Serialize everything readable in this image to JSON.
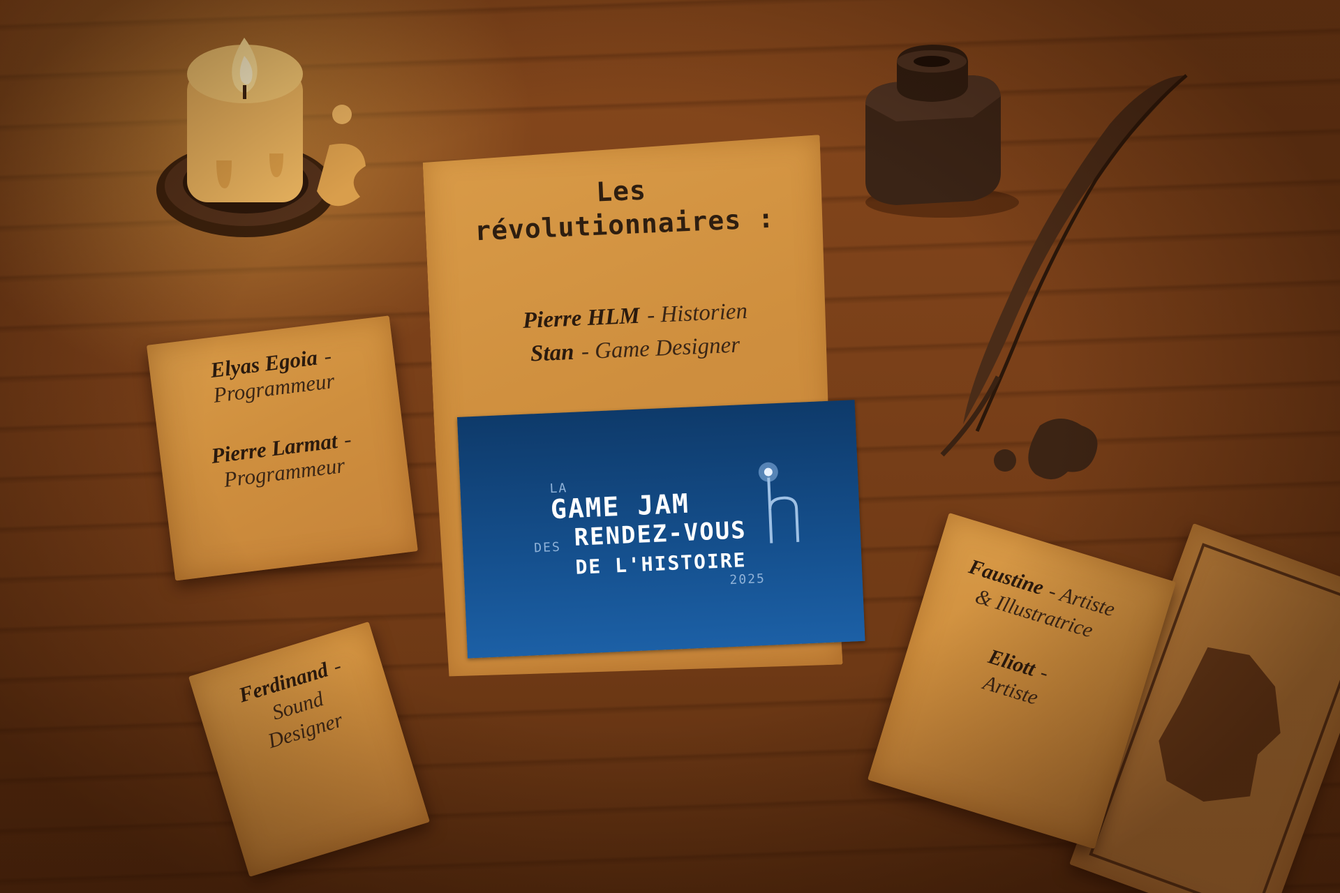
{
  "main_paper": {
    "title_line1": "Les",
    "title_line2": "révolutionnaires :",
    "members": [
      {
        "name": "Pierre HLM",
        "role": "- Historien"
      },
      {
        "name": "Stan",
        "role": "- Game Designer"
      }
    ]
  },
  "banner": {
    "la": "LA",
    "game_jam": "GAME JAM",
    "des": "DES",
    "rendez_vous": "RENDEZ-VOUS",
    "histoire": "DE L'HISTOIRE",
    "year": "2025",
    "logo_letter": "h"
  },
  "left_note": {
    "name1": "Elyas Egoia",
    "dash1": "-",
    "role1": "Programmeur",
    "name2": "Pierre Larmat",
    "dash2": "-",
    "role2": "Programmeur"
  },
  "bottom_left_note": {
    "name": "Ferdinand",
    "dash": "-",
    "role_line1": "Sound",
    "role_line2": "Designer"
  },
  "right_note": {
    "name1": "Faustine",
    "role1_line1": "- Artiste",
    "role1_line2": "& Illustratrice",
    "name2": "Eliott",
    "dash2": "-",
    "role2": "Artiste"
  },
  "icons": [
    "candle-icon",
    "inkwell-icon",
    "quill-icon",
    "map-icon"
  ]
}
